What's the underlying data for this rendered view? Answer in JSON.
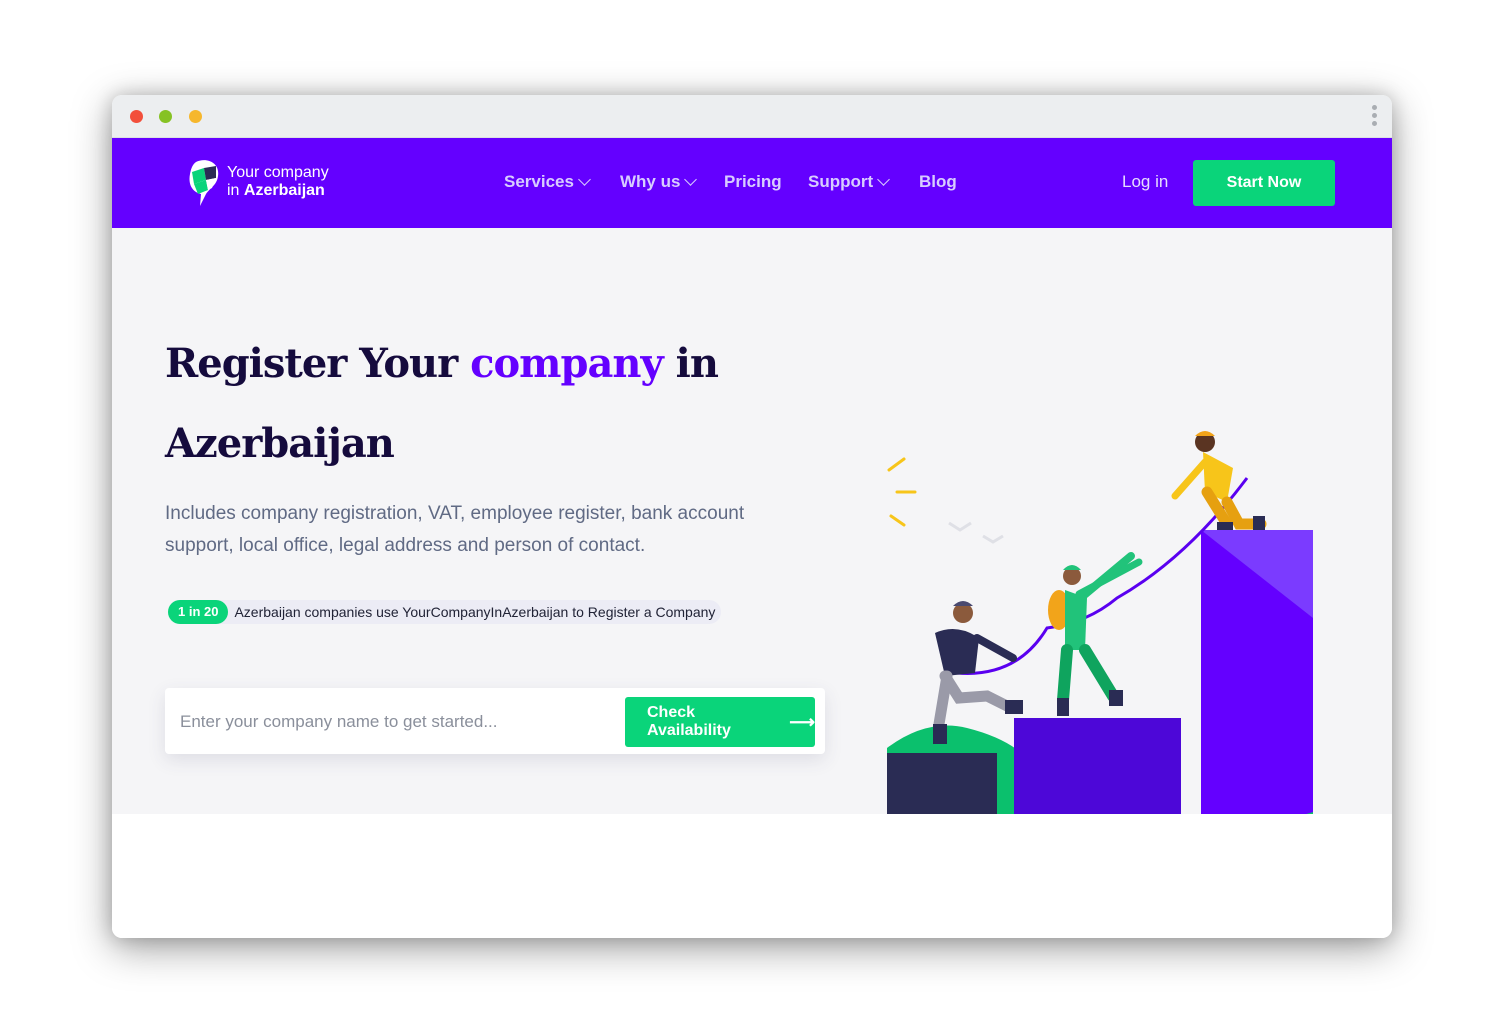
{
  "window": {
    "title_bar_dots": [
      "red",
      "green",
      "yellow"
    ]
  },
  "brand": {
    "line1": "Your company",
    "line2_prefix": "in ",
    "line2_bold": "Azerbaijan",
    "color": "#6400ff",
    "accent": "#0ad47a"
  },
  "nav": {
    "items": [
      {
        "label": "Services",
        "dropdown": true
      },
      {
        "label": "Why us",
        "dropdown": true
      },
      {
        "label": "Pricing",
        "dropdown": false
      },
      {
        "label": "Support",
        "dropdown": true
      },
      {
        "label": "Blog",
        "dropdown": false
      }
    ],
    "login_label": "Log in",
    "cta_label": "Start Now"
  },
  "hero": {
    "title_part1": "Register Your ",
    "title_accent": "company",
    "title_part2": " in",
    "title_line2": "Azerbaijan",
    "subtitle": "Includes company registration, VAT, employee register, bank account support, local office, legal address and person of contact.",
    "stat_badge": "1 in 20",
    "stat_text": "Azerbaijan companies use YourCompanyInAzerbaijan to Register a Company",
    "search_placeholder": "Enter your company name to get started...",
    "search_button": "Check Availability",
    "search_button_icon": "arrow-right-icon"
  }
}
